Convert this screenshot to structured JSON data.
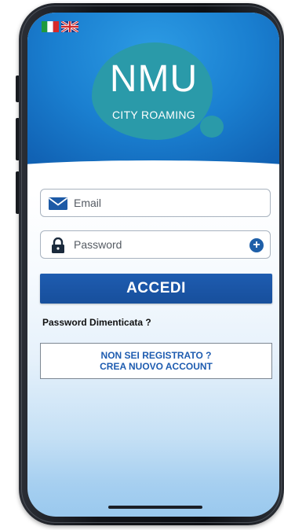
{
  "app": {
    "logo_title": "NMU",
    "logo_subtitle": "CITY ROAMING"
  },
  "languages": [
    {
      "code": "it",
      "icon": "italy-flag-icon"
    },
    {
      "code": "en",
      "icon": "uk-flag-icon"
    }
  ],
  "login_form": {
    "email_placeholder": "Email",
    "email_icon": "envelope-icon",
    "password_placeholder": "Password",
    "password_icon": "lock-icon",
    "reveal_icon": "plus-circle-icon",
    "submit_label": "ACCEDI",
    "forgot_password_label": "Password Dimenticata ?"
  },
  "register": {
    "line1": "NON SEI REGISTRATO ?",
    "line2": "CREA NUOVO ACCOUNT"
  },
  "colors": {
    "header_blue": "#1a7fd0",
    "logo_teal": "#2a9aa9",
    "primary_button": "#1e5cb0",
    "link_blue": "#1e5cb0"
  }
}
